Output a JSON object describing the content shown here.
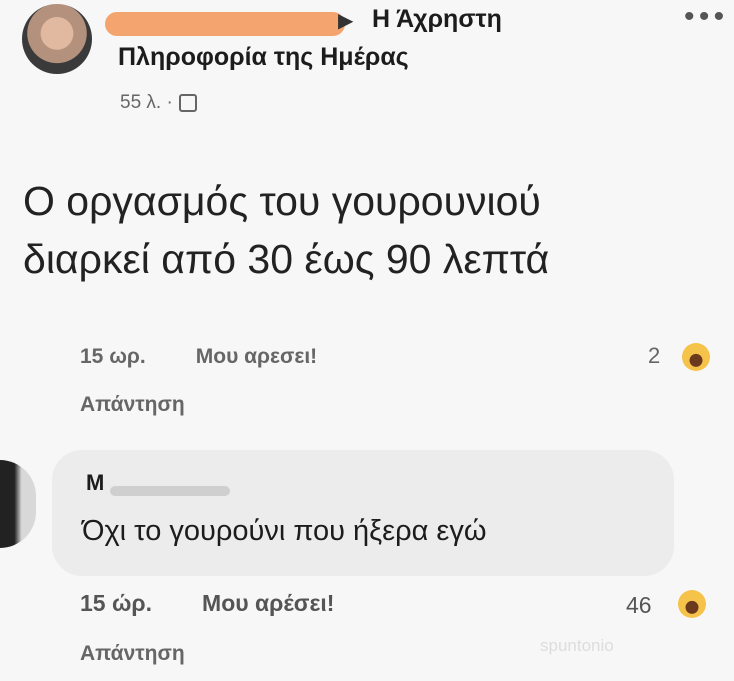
{
  "post": {
    "group_name_line1": "Η Άχρηστη",
    "group_name_line2": "Πληροφορία της Ημέρας",
    "timestamp": "55 λ. ·",
    "text_line1": "Ο οργασμός του γουρουνιού",
    "text_line2": "διαρκεί από 30 έως 90 λεπτά"
  },
  "comment1": {
    "time": "15 ωρ.",
    "like": "Μου αρεσει!",
    "reply": "Απάντηση",
    "reaction_count": "2"
  },
  "comment2": {
    "author": "M",
    "text": "Όχι το γουρούνι που ήξερα εγώ",
    "time": "15 ώρ.",
    "like": "Μου αρέσει!",
    "reply": "Απάντηση",
    "reaction_count": "46"
  },
  "icons": {
    "more": "more-icon",
    "privacy": "globe-icon",
    "reaction": "haha-reaction-icon"
  },
  "watermark": "spuntonio"
}
